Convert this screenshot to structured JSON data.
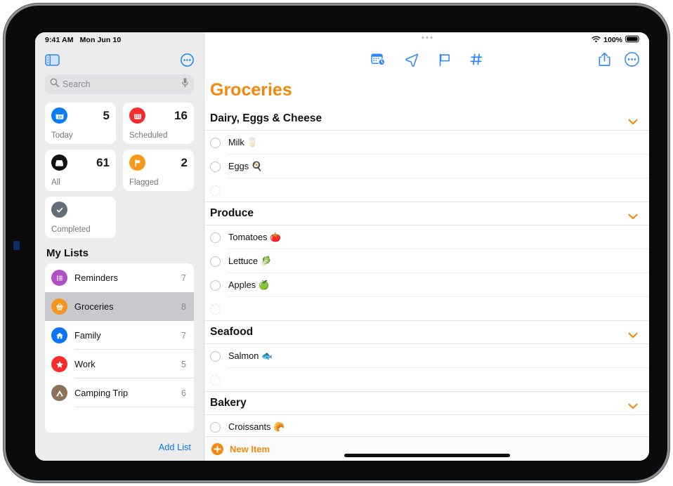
{
  "status_bar": {
    "time": "9:41 AM",
    "date": "Mon Jun 10",
    "battery_percent": "100%",
    "wifi_icon": "wifi-icon",
    "battery_icon": "battery-icon"
  },
  "sidebar": {
    "toggle_icon": "sidebar-toggle-icon",
    "more_icon": "more-circle-icon",
    "search": {
      "placeholder": "Search",
      "search_icon": "search-icon",
      "mic_icon": "microphone-icon"
    },
    "smart_lists": [
      {
        "label": "Today",
        "count": "5",
        "icon": "calendar-day-icon",
        "color": "#0a7cf5"
      },
      {
        "label": "Scheduled",
        "count": "16",
        "icon": "calendar-icon",
        "color": "#f42c2c"
      },
      {
        "label": "All",
        "count": "61",
        "icon": "inbox-tray-icon",
        "color": "#111111"
      },
      {
        "label": "Flagged",
        "count": "2",
        "icon": "flag-icon",
        "color": "#f7981d"
      },
      {
        "label": "Completed",
        "count": "",
        "icon": "checkmark-icon",
        "color": "#656d77"
      }
    ],
    "my_lists_title": "My Lists",
    "lists": [
      {
        "name": "Reminders",
        "count": "7",
        "icon": "bulleted-list-icon",
        "color": "#b24fc8",
        "selected": false
      },
      {
        "name": "Groceries",
        "count": "8",
        "icon": "basket-icon",
        "color": "#f5951d",
        "selected": true
      },
      {
        "name": "Family",
        "count": "7",
        "icon": "house-icon",
        "color": "#0a76f5",
        "selected": false
      },
      {
        "name": "Work",
        "count": "5",
        "icon": "star-icon",
        "color": "#f42c2c",
        "selected": false
      },
      {
        "name": "Camping Trip",
        "count": "6",
        "icon": "tent-icon",
        "color": "#8a7358",
        "selected": false
      }
    ],
    "add_list_label": "Add List"
  },
  "main": {
    "window_handle_icon": "window-handle-ellipsis-icon",
    "toolbar": {
      "center_icons": [
        {
          "name": "remind-me-date-icon"
        },
        {
          "name": "location-arrow-icon"
        },
        {
          "name": "flag-icon"
        },
        {
          "name": "tag-hash-icon"
        }
      ],
      "right_icons": [
        {
          "name": "share-icon"
        },
        {
          "name": "more-circle-icon"
        }
      ]
    },
    "page_title": "Groceries",
    "accent_color": "#f5880b",
    "sections": [
      {
        "title": "Dairy, Eggs & Cheese",
        "chevron_icon": "chevron-down-icon",
        "items": [
          {
            "text": "Milk 🥛"
          },
          {
            "text": "Eggs 🍳"
          },
          {
            "text": ""
          }
        ]
      },
      {
        "title": "Produce",
        "chevron_icon": "chevron-down-icon",
        "items": [
          {
            "text": "Tomatoes 🍅"
          },
          {
            "text": "Lettuce 🥬"
          },
          {
            "text": "Apples 🍏"
          },
          {
            "text": ""
          }
        ]
      },
      {
        "title": "Seafood",
        "chevron_icon": "chevron-down-icon",
        "items": [
          {
            "text": "Salmon 🐟"
          },
          {
            "text": ""
          }
        ]
      },
      {
        "title": "Bakery",
        "chevron_icon": "chevron-down-icon",
        "items": [
          {
            "text": "Croissants 🥐"
          }
        ]
      }
    ],
    "new_item": {
      "label": "New Item",
      "icon": "plus-circle-icon"
    }
  }
}
